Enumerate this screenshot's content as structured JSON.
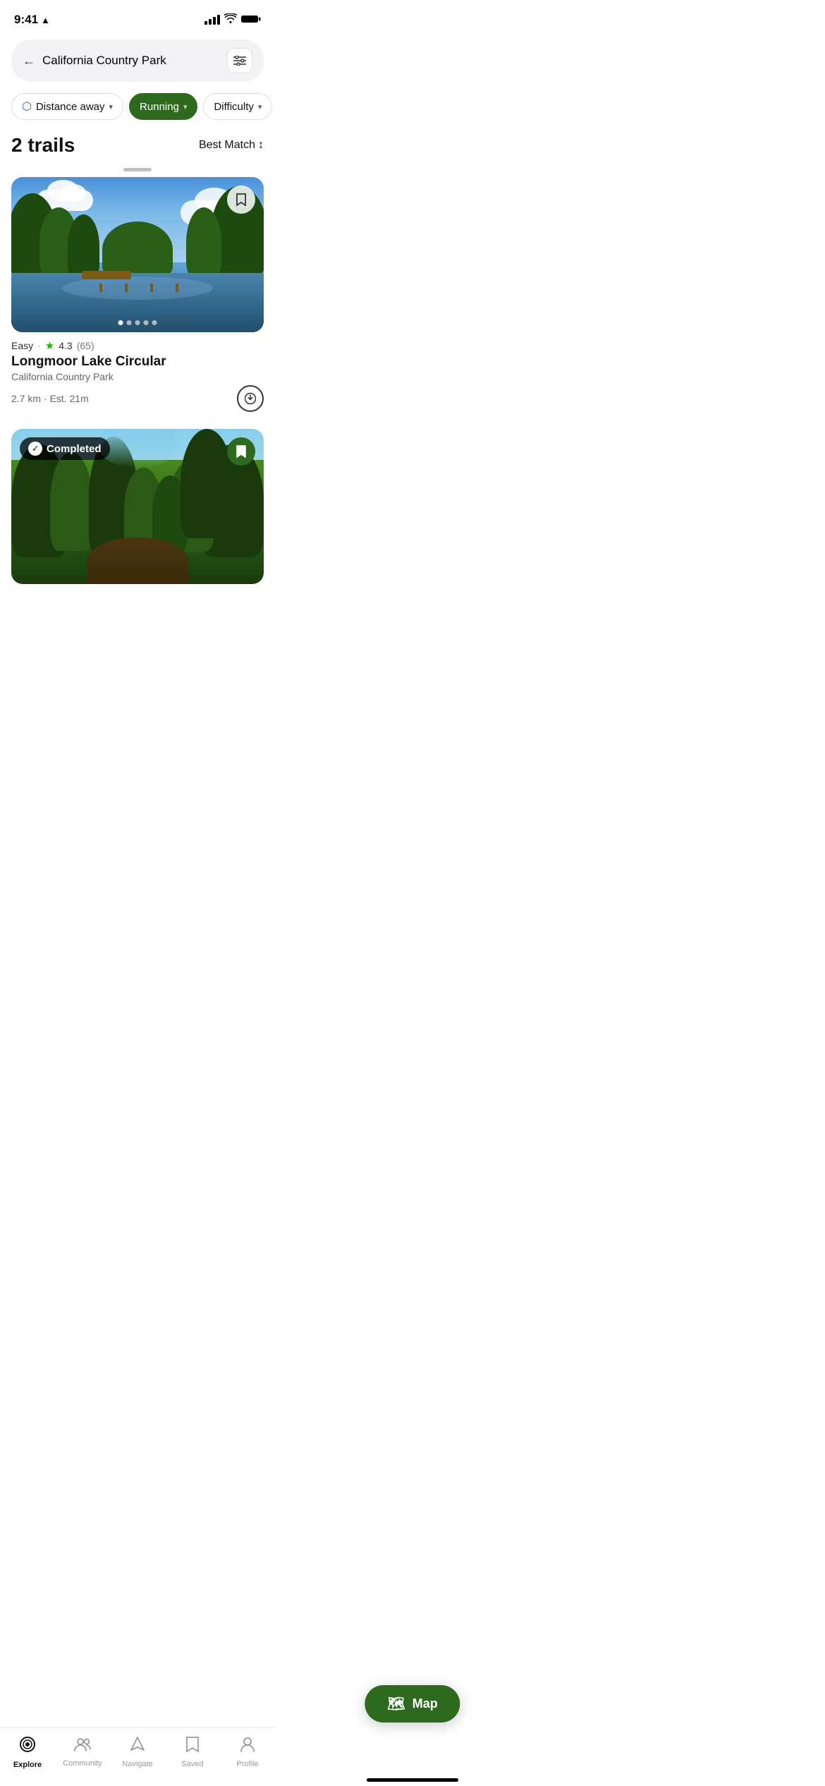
{
  "statusBar": {
    "time": "9:41",
    "locationArrow": "▶"
  },
  "searchBar": {
    "backArrow": "←",
    "placeholder": "California Country Park",
    "filterIcon": "⊟"
  },
  "filters": [
    {
      "id": "distance",
      "label": "Distance away",
      "icon": "⬡",
      "active": false
    },
    {
      "id": "running",
      "label": "Running",
      "icon": "",
      "active": true
    },
    {
      "id": "difficulty",
      "label": "Difficulty",
      "icon": "",
      "active": false
    }
  ],
  "results": {
    "count": "2 trails",
    "sortLabel": "Best Match",
    "sortIcon": "↕"
  },
  "trails": [
    {
      "id": "trail-1",
      "difficulty": "Easy",
      "rating": "4.3",
      "reviewCount": "(65)",
      "name": "Longmoor Lake Circular",
      "location": "California Country Park",
      "distance": "2.7 km",
      "estTime": "Est. 21m",
      "bookmarked": false,
      "completed": false,
      "dots": 5,
      "activeDot": 0
    },
    {
      "id": "trail-2",
      "difficulty": "",
      "rating": "",
      "reviewCount": "",
      "name": "",
      "location": "",
      "distance": "",
      "estTime": "",
      "bookmarked": true,
      "completed": true,
      "completedLabel": "Completed",
      "dots": 0,
      "activeDot": 0
    }
  ],
  "mapButton": {
    "icon": "🗺",
    "label": "Map"
  },
  "bottomNav": [
    {
      "id": "explore",
      "icon": "explore",
      "label": "Explore",
      "active": true
    },
    {
      "id": "community",
      "icon": "community",
      "label": "Community",
      "active": false
    },
    {
      "id": "navigate",
      "icon": "navigate",
      "label": "Navigate",
      "active": false
    },
    {
      "id": "saved",
      "icon": "saved",
      "label": "Saved",
      "active": false
    },
    {
      "id": "profile",
      "icon": "profile",
      "label": "Profile",
      "active": false
    }
  ]
}
